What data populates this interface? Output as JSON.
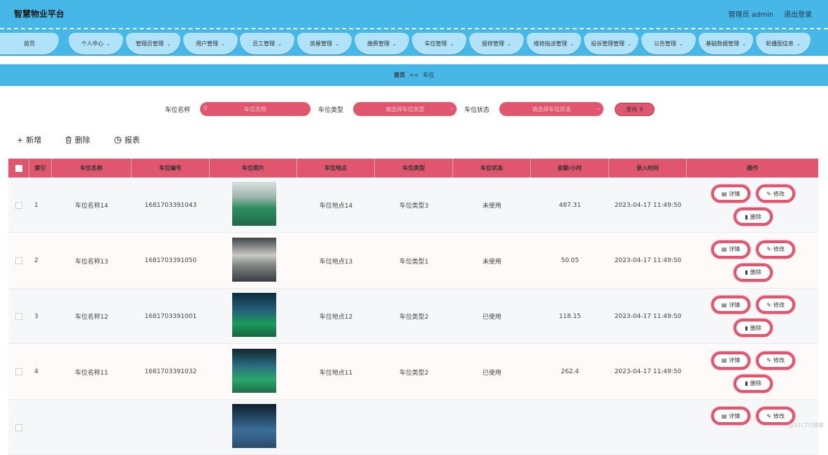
{
  "header": {
    "title": "智慧物业平台",
    "user": "管理员 admin",
    "logout": "退出登录"
  },
  "nav": [
    {
      "label": "首页",
      "chev": false
    },
    {
      "label": "个人中心",
      "chev": true
    },
    {
      "label": "管理员管理",
      "chev": true
    },
    {
      "label": "用户管理",
      "chev": true
    },
    {
      "label": "员工管理",
      "chev": true
    },
    {
      "label": "房屋管理",
      "chev": true
    },
    {
      "label": "缴费管理",
      "chev": true
    },
    {
      "label": "车位管理",
      "chev": true
    },
    {
      "label": "报修管理",
      "chev": true
    },
    {
      "label": "维修指派管理",
      "chev": true
    },
    {
      "label": "投诉管理管理",
      "chev": true
    },
    {
      "label": "公告管理",
      "chev": true
    },
    {
      "label": "基础数据管理",
      "chev": true
    },
    {
      "label": "轮播图信息",
      "chev": true
    }
  ],
  "breadcrumb": {
    "home": "首页",
    "sep": "<<",
    "current": "车位"
  },
  "search": {
    "name_label": "车位名称",
    "name_placeholder": "车位名称",
    "type_label": "车位类型",
    "type_placeholder": "请选择车位类型",
    "status_label": "车位状态",
    "status_placeholder": "请选择车位状态",
    "query": "查询"
  },
  "actions": {
    "add": "新增",
    "delete": "删除",
    "report": "报表"
  },
  "table": {
    "columns": [
      "索引",
      "车位名称",
      "车位编号",
      "车位照片",
      "车位地点",
      "车位类型",
      "车位状态",
      "金额/小时",
      "录入时间",
      "操作"
    ],
    "row_buttons": {
      "detail": "详情",
      "edit": "修改",
      "delete": "删除"
    },
    "rows": [
      {
        "index": "1",
        "name": "车位名称14",
        "code": "1681703391043",
        "place": "车位地点14",
        "type": "车位类型3",
        "status": "未使用",
        "price": "487.31",
        "time": "2023-04-17 11:49:50"
      },
      {
        "index": "2",
        "name": "车位名称13",
        "code": "1681703391050",
        "place": "车位地点13",
        "type": "车位类型1",
        "status": "未使用",
        "price": "50.05",
        "time": "2023-04-17 11:49:50"
      },
      {
        "index": "3",
        "name": "车位名称12",
        "code": "1681703391001",
        "place": "车位地点12",
        "type": "车位类型2",
        "status": "已使用",
        "price": "118.15",
        "time": "2023-04-17 11:49:50"
      },
      {
        "index": "4",
        "name": "车位名称11",
        "code": "1681703391032",
        "place": "车位地点11",
        "type": "车位类型2",
        "status": "已使用",
        "price": "262.4",
        "time": "2023-04-17 11:49:50"
      },
      {
        "index": "",
        "name": "",
        "code": "",
        "place": "",
        "type": "",
        "status": "",
        "price": "",
        "time": ""
      }
    ]
  },
  "watermark": "@51CTO博客"
}
